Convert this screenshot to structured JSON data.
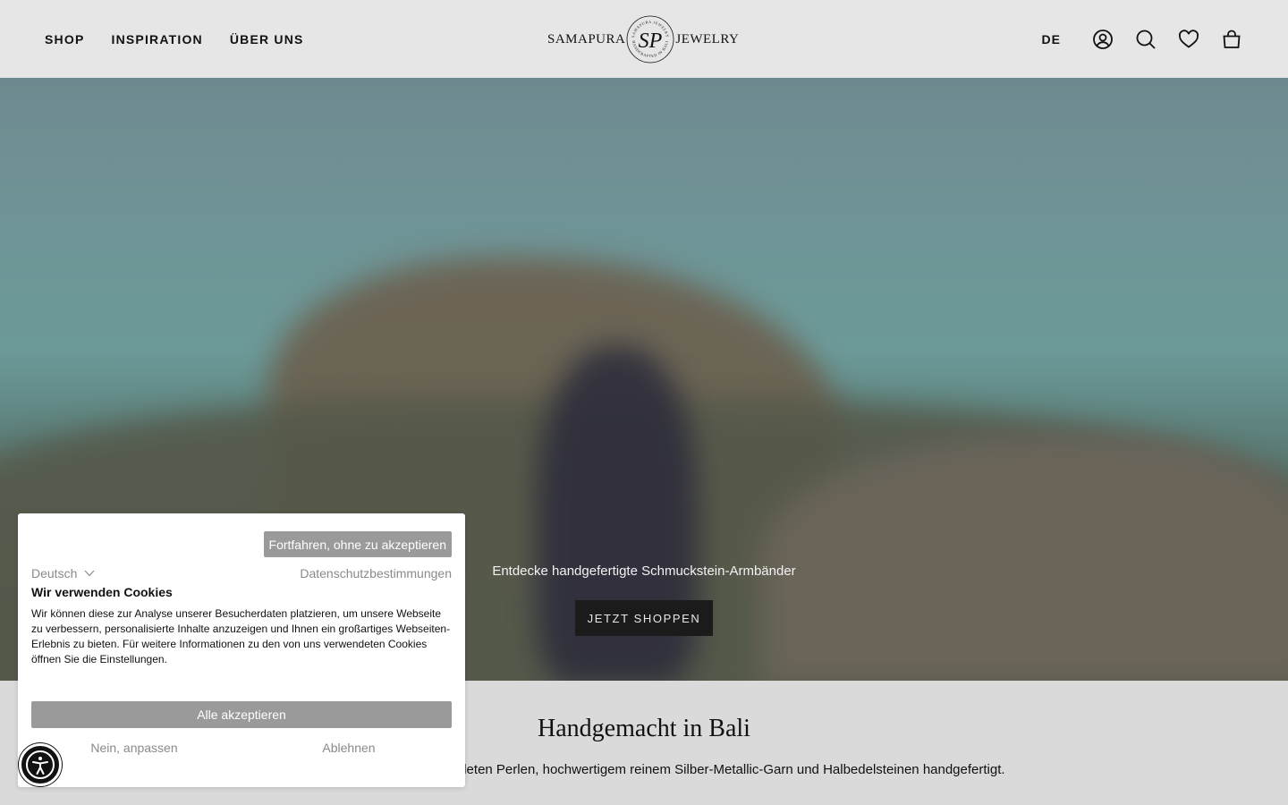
{
  "header": {
    "nav": [
      {
        "label": "SHOP"
      },
      {
        "label": "INSPIRATION"
      },
      {
        "label": "ÜBER UNS"
      }
    ],
    "logo": {
      "left_word": "SAMAPURA",
      "right_word": "JEWELRY",
      "seal_ring_top": "SAMAPURA JEWELRY",
      "seal_ring_bottom": "HANDCRAFTED IN BALI",
      "seal_monogram": "SP"
    },
    "language": "DE",
    "icons": [
      "account-icon",
      "search-icon",
      "wishlist-heart-icon",
      "cart-bag-icon"
    ]
  },
  "hero": {
    "caption": "Entdecke handgefertigte Schmuckstein-Armbänder",
    "cta_label": "JETZT SHOPPEN"
  },
  "intro": {
    "title": "Handgemacht in Bali",
    "text": "nik mit handgefertigten vergoldeten Perlen, hochwertigem reinem Silber-Metallic-Garn und Halbedelsteinen handgefertigt."
  },
  "cookie": {
    "continue_label": "Fortfahren, ohne zu akzeptieren",
    "language": "Deutsch",
    "privacy_link": "Datenschutzbestimmungen",
    "title": "Wir verwenden Cookies",
    "body": "Wir können diese zur Analyse unserer Besucherdaten platzieren, um unsere Webseite zu verbessern, personalisierte Inhalte anzuzeigen und Ihnen ein großartiges Webseiten-Erlebnis zu bieten. Für weitere Informationen zu den von uns verwendeten Cookies öffnen Sie die Einstellungen.",
    "accept_all": "Alle akzeptieren",
    "customize": "Nein, anpassen",
    "reject": "Ablehnen"
  },
  "colors": {
    "header_bg": "#e6e6e6",
    "cta_bg": "#1b1b1b",
    "cookie_button_bg": "#9a9a9a",
    "muted_text": "#8a8a8a"
  }
}
